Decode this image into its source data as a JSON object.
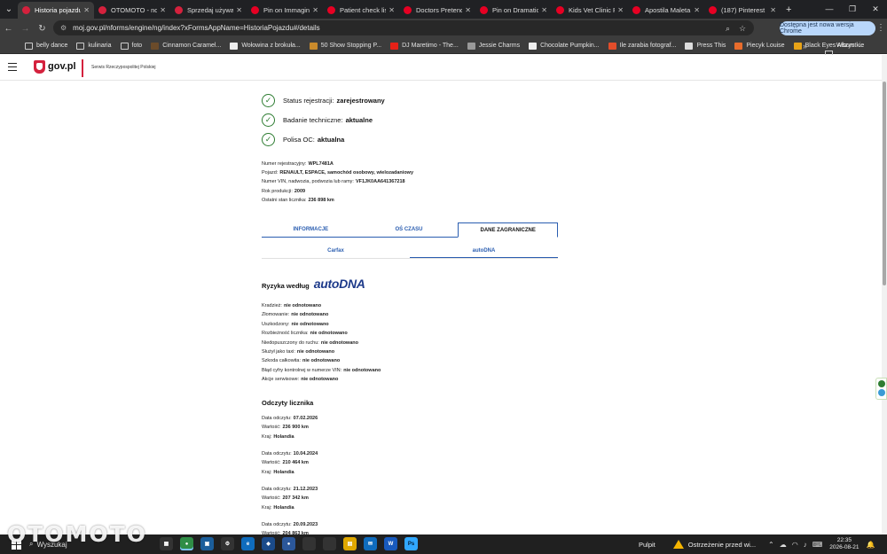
{
  "browser": {
    "tabs": [
      {
        "title": "Historia pojazdu",
        "color": "#d4213d"
      },
      {
        "title": "OTOMOTO - nowe",
        "color": "#d4213d"
      },
      {
        "title": "Sprzedaj używane",
        "color": "#d4213d"
      },
      {
        "title": "Pin on Immagini",
        "color": "#e60023"
      },
      {
        "title": "Patient check list",
        "color": "#e60023"
      },
      {
        "title": "Doctors Pretend",
        "color": "#e60023"
      },
      {
        "title": "Pin on Dramatic",
        "color": "#e60023"
      },
      {
        "title": "Kids Vet Clinic Pa",
        "color": "#e60023"
      },
      {
        "title": "Apostila Maleta M",
        "color": "#e60023"
      },
      {
        "title": "(187) Pinterest",
        "color": "#e60023"
      }
    ],
    "url": "moj.gov.pl/nforms/engine/ng/index?xFormsAppName=HistoriaPojazdu#/details",
    "update_button": "Dostępna jest nowa wersja Chrome",
    "bookmarks": [
      {
        "label": "belly dance",
        "color": "folder"
      },
      {
        "label": "kulinaria",
        "color": "folder"
      },
      {
        "label": "foto",
        "color": "folder"
      },
      {
        "label": "Cinnamon Caramel...",
        "color": "#6b4b2a"
      },
      {
        "label": "Wołowina z brokuła...",
        "color": "#eeeeee"
      },
      {
        "label": "50 Show Stopping P...",
        "color": "#c98a2b"
      },
      {
        "label": "DJ Maretimo - The...",
        "color": "#e62117"
      },
      {
        "label": "Jessie Charms",
        "color": "#999999"
      },
      {
        "label": "Chocolate Pumpkin...",
        "color": "#eeeeee"
      },
      {
        "label": "Ile zarabia fotograf...",
        "color": "#e34d2a"
      },
      {
        "label": "Press This",
        "color": "#dddddd"
      },
      {
        "label": "Piecyk Louise",
        "color": "#e86c2c"
      },
      {
        "label": "Black Eyes Album -...",
        "color": "#e8a317"
      }
    ],
    "bookmarks_all": "Wszystkie zakładki"
  },
  "site": {
    "logo": "gov.pl",
    "subtitle": "Serwis Rzeczypospolitej Polskiej"
  },
  "status": [
    {
      "label": "Status rejestracji:",
      "value": "zarejestrowany"
    },
    {
      "label": "Badanie techniczne:",
      "value": "aktualne"
    },
    {
      "label": "Polisa OC:",
      "value": "aktualna"
    }
  ],
  "vehicle": [
    {
      "label": "Numer rejestracyjny:",
      "value": "WPL7481A"
    },
    {
      "label": "Pojazd:",
      "value": "RENAULT, ESPACE, samochód osobowy, wielozadaniowy"
    },
    {
      "label": "Numer VIN, nadwozia, podwozia lub ramy:",
      "value": "VF1JK0AA641367218"
    },
    {
      "label": "Rok produkcji:",
      "value": "2009"
    },
    {
      "label": "Ostatni stan licznika:",
      "value": "236 898 km"
    }
  ],
  "tabs": {
    "main": [
      "INFORMACJE",
      "OŚ CZASU",
      "DANE ZAGRANICZNE"
    ],
    "sub": [
      "Carfax",
      "autoDNA"
    ]
  },
  "risk": {
    "title": "Ryzyka według",
    "brand": "autoDNA",
    "items": [
      {
        "label": "Kradzież:",
        "value": "nie odnotowano"
      },
      {
        "label": "Złomowanie:",
        "value": "nie odnotowano"
      },
      {
        "label": "Uszkodzony:",
        "value": "nie odnotowano"
      },
      {
        "label": "Rozbieżność licznika:",
        "value": "nie odnotowano"
      },
      {
        "label": "Niedopuszczony do ruchu:",
        "value": "nie odnotowano"
      },
      {
        "label": "Służył jako taxi:",
        "value": "nie odnotowano"
      },
      {
        "label": "Szkoda całkowita:",
        "value": "nie odnotowano"
      },
      {
        "label": "Błąd cyfry kontrolnej w numerze VIN:",
        "value": "nie odnotowano"
      },
      {
        "label": "Akcje serwisowe:",
        "value": "nie odnotowano"
      }
    ]
  },
  "odometer": {
    "title": "Odczyty licznika",
    "labels": {
      "date": "Data odczytu:",
      "value": "Wartość:",
      "country": "Kraj:"
    },
    "readings": [
      {
        "date": "07.02.2026",
        "value": "236 900 km",
        "country": "Holandia"
      },
      {
        "date": "10.04.2024",
        "value": "210 464 km",
        "country": "Holandia"
      },
      {
        "date": "21.12.2023",
        "value": "207 342 km",
        "country": "Holandia"
      },
      {
        "date": "20.09.2023",
        "value": "204 863 km",
        "country": ""
      }
    ]
  },
  "taskbar": {
    "search": "Wyszukaj",
    "pulpit": "Pulpit",
    "warning": "Ostrzeżenie przed wi...",
    "time": "22:35",
    "date": "2026-08-21",
    "watermark": "OTOMOTO"
  }
}
